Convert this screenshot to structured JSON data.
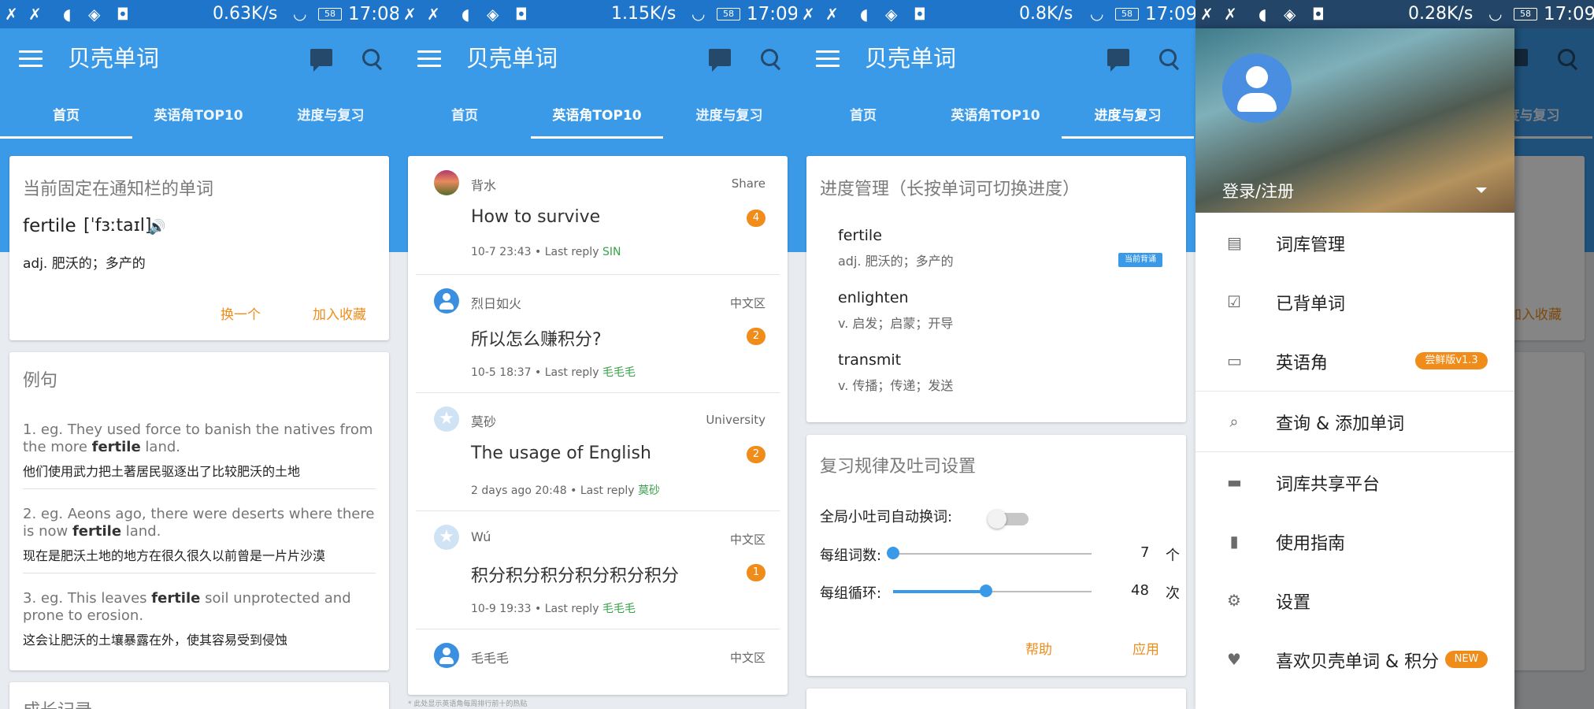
{
  "app": {
    "title": "贝壳单词"
  },
  "tabs": [
    "首页",
    "英语角TOP10",
    "进度与复习"
  ],
  "status_bars": [
    {
      "speed": "0.63K/s",
      "battery": "58",
      "time": "17:08"
    },
    {
      "speed": "1.15K/s",
      "battery": "58",
      "time": "17:09"
    },
    {
      "speed": "0.8K/s",
      "battery": "58",
      "time": "17:09"
    },
    {
      "speed": "0.28K/s",
      "battery": "58",
      "time": "17:09"
    }
  ],
  "home": {
    "pinned_title": "当前固定在通知栏的单词",
    "word": "fertile",
    "phonetic": "[ˈfɜːtaɪl]",
    "meaning": "adj.  肥沃的；多产的",
    "change_button": "换一个",
    "favorite_button": "加入收藏",
    "examples_title": "例句",
    "examples": [
      {
        "pre": "1.  eg. They used force to banish the natives from the more ",
        "bold": "fertile",
        "post": " land.",
        "zh": "他们使用武力把土著居民驱逐出了比较肥沃的土地"
      },
      {
        "pre": "2.  eg. Aeons ago, there were deserts where there is now ",
        "bold": "fertile",
        "post": " land.",
        "zh": "现在是肥沃土地的地方在很久很久以前曾是一片片沙漠"
      },
      {
        "pre": "3.  eg. This leaves ",
        "bold": "fertile",
        "post": " soil unprotected and prone to erosion.",
        "zh": "这会让肥沃的土壤暴露在外，使其容易受到侵蚀"
      }
    ],
    "growth_title": "成长记录"
  },
  "top10": {
    "posts": [
      {
        "user": "背水",
        "board": "Share",
        "title": "How to survive",
        "count": "4",
        "time": "10-7 23:43",
        "last_reply_label": "Last reply",
        "replier": "SIN"
      },
      {
        "user": "烈日如火",
        "board": "中文区",
        "title": "所以怎么赚积分?",
        "count": "2",
        "time": "10-5 18:37",
        "last_reply_label": "Last reply",
        "replier": "毛毛毛"
      },
      {
        "user": "莫砂",
        "board": "University",
        "title": "The usage of English",
        "count": "2",
        "time": "2 days ago 20:48",
        "last_reply_label": "Last reply",
        "replier": "莫砂"
      },
      {
        "user": "Wú",
        "board": "中文区",
        "title": "积分积分积分积分积分积分",
        "count": "1",
        "time": "10-9 19:33",
        "last_reply_label": "Last reply",
        "replier": "毛毛毛"
      },
      {
        "user": "毛毛毛",
        "board": "中文区"
      }
    ],
    "footnote": "* 此处显示英语角每周排行前十的热贴"
  },
  "progress": {
    "manage_title": "进度管理（长按单词可切换进度）",
    "words": [
      {
        "word": "fertile",
        "def": "adj.  肥沃的；多产的",
        "tag": "当前背诵"
      },
      {
        "word": "enlighten",
        "def": "v.  启发；启蒙；开导"
      },
      {
        "word": "transmit",
        "def": "v.  传播；传递；发送"
      }
    ],
    "review_title": "复习规律及吐司设置",
    "auto_toast_label": "全局小吐司自动换词:",
    "group_words_label": "每组词数:",
    "group_words_value": "7",
    "group_words_unit": "个",
    "group_words_fraction": 0.0,
    "group_cycles_label": "每组循环:",
    "group_cycles_value": "48",
    "group_cycles_unit": "次",
    "group_cycles_fraction": 0.47,
    "help_button": "帮助",
    "apply_button": "应用"
  },
  "drawer": {
    "login": "登录/注册",
    "items": [
      {
        "label": "词库管理",
        "icon": "clipboard-icon"
      },
      {
        "label": "已背单词",
        "icon": "clipboard-check-icon"
      },
      {
        "label": "英语角",
        "icon": "chat-icon",
        "tag": "尝鲜版v1.3"
      },
      {
        "label": "查询 & 添加单词",
        "icon": "search-document-icon"
      },
      {
        "label": "词库共享平台",
        "icon": "monitor-icon"
      },
      {
        "label": "使用指南",
        "icon": "book-icon"
      },
      {
        "label": "设置",
        "icon": "gear-icon"
      },
      {
        "label": "喜欢贝壳单词 & 积分",
        "icon": "heart-icon",
        "tag": "NEW"
      }
    ]
  },
  "colors": {
    "primary": "#3b9ae8",
    "accent": "#f08c1a",
    "status_bar": "#1f75c9"
  }
}
